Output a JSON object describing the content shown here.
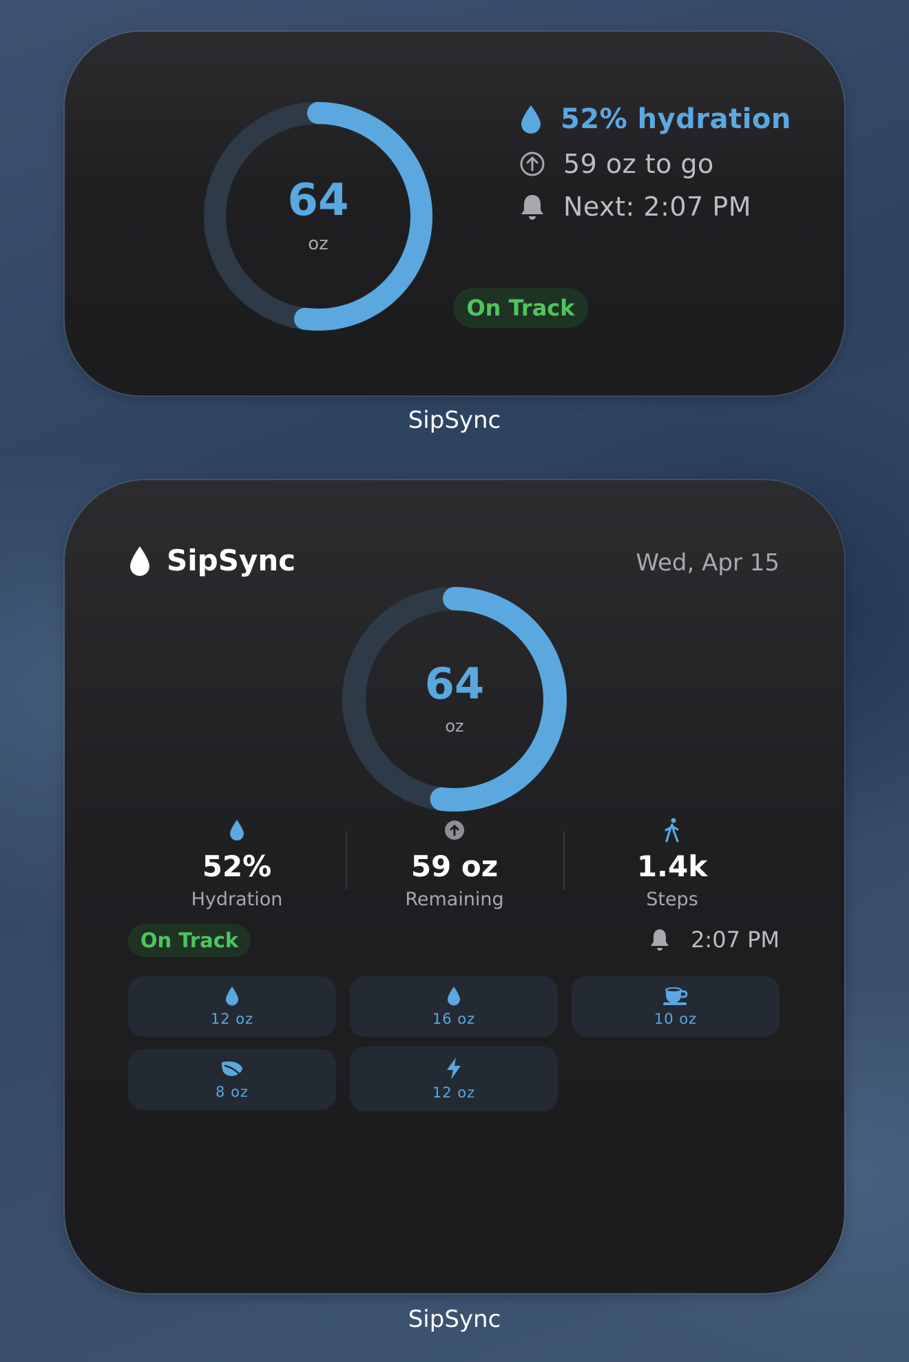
{
  "colors": {
    "accent": "#5ba8e0",
    "ring_track": "#2e3a47",
    "on_track_text": "#4fc45f",
    "on_track_bg": "#1f3324",
    "widget_bg": "#1c1c1e"
  },
  "small_widget": {
    "ring": {
      "value": "64",
      "unit": "oz",
      "progress_fraction": 0.52
    },
    "hydration_text": "52% hydration",
    "remaining_text": "59 oz to go",
    "next_text": "Next: 2:07 PM",
    "status_badge": "On Track",
    "caption": "SipSync",
    "icons": [
      "water-drop-icon",
      "arrow-up-circle-icon",
      "bell-icon"
    ]
  },
  "large_widget": {
    "app_title": "SipSync",
    "date": "Wed, Apr 15",
    "ring": {
      "value": "64",
      "unit": "oz",
      "progress_fraction": 0.52
    },
    "stats": [
      {
        "icon": "water-drop-icon",
        "value": "52%",
        "label": "Hydration"
      },
      {
        "icon": "arrow-up-circle-icon",
        "value": "59 oz",
        "label": "Remaining"
      },
      {
        "icon": "walking-figure-icon",
        "value": "1.4k",
        "label": "Steps"
      }
    ],
    "status_badge": "On Track",
    "reminder_time": "2:07 PM",
    "quick_add": [
      {
        "icon": "water-drop-icon",
        "label": "12 oz"
      },
      {
        "icon": "water-drop-icon",
        "label": "16 oz"
      },
      {
        "icon": "coffee-cup-icon",
        "label": "10 oz"
      },
      {
        "icon": "leaf-icon",
        "label": "8 oz"
      },
      {
        "icon": "lightning-bolt-icon",
        "label": "12 oz"
      }
    ],
    "caption": "SipSync"
  }
}
